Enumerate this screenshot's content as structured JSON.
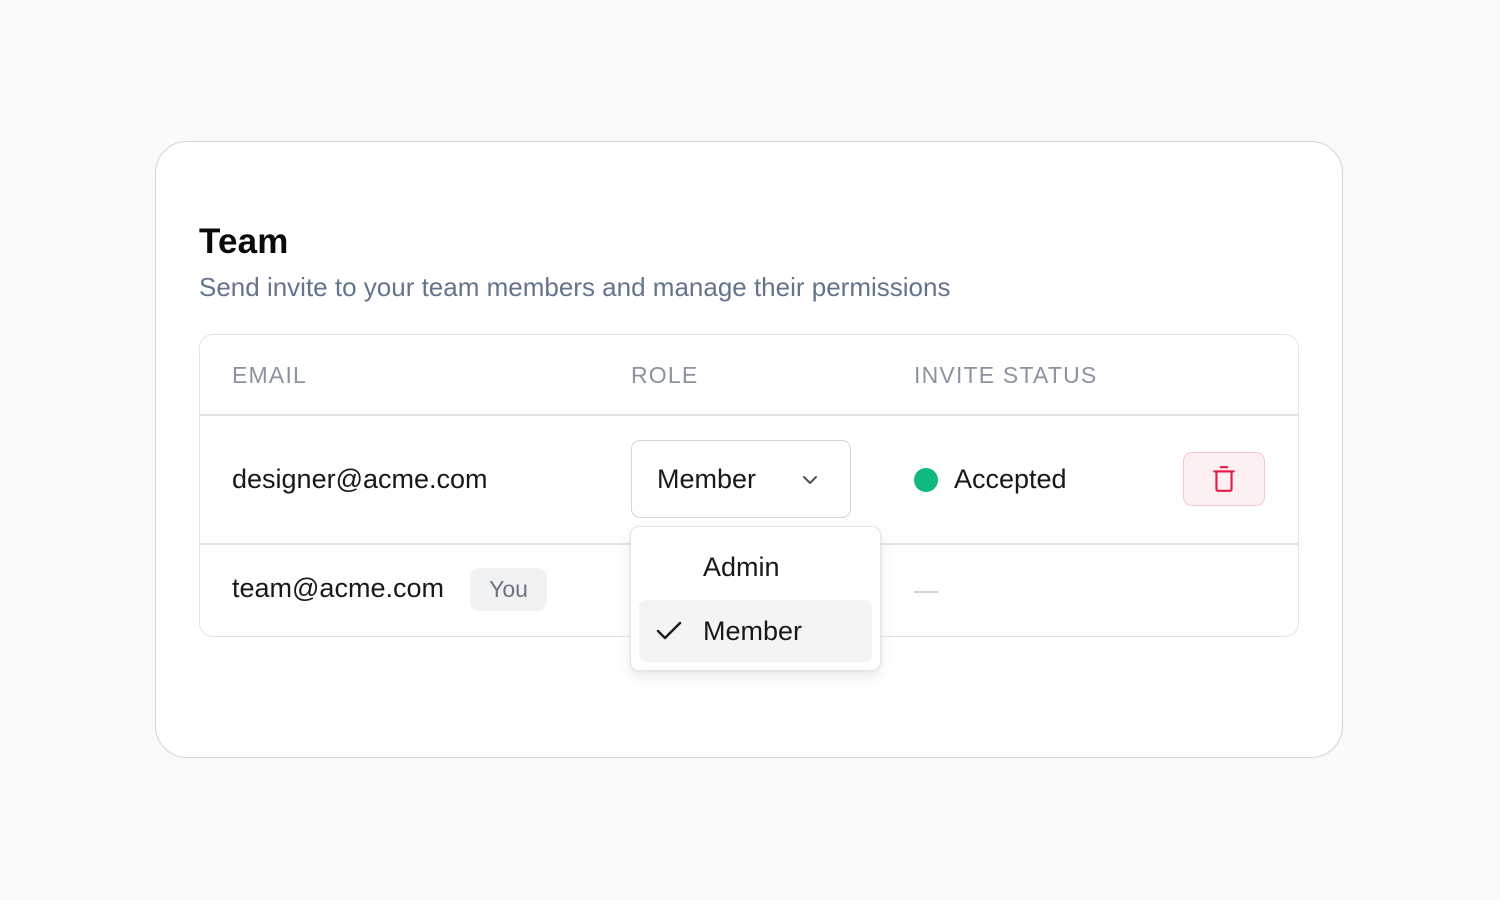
{
  "card": {
    "title": "Team",
    "subtitle": "Send invite to your team members and manage their permissions"
  },
  "table": {
    "columns": [
      "EMAIL",
      "ROLE",
      "INVITE STATUS"
    ],
    "rows": [
      {
        "email": "designer@acme.com",
        "role": "Member",
        "status": "Accepted",
        "status_color": "#10b981",
        "action_icon": "trash-icon"
      },
      {
        "email": "team@acme.com",
        "badge": "You",
        "role": "",
        "status": "—"
      }
    ]
  },
  "role_dropdown": {
    "open": true,
    "selected": "Member",
    "options": [
      "Admin",
      "Member"
    ]
  },
  "colors": {
    "accent_success": "#10b981",
    "danger": "#e11d48",
    "danger_bg": "#fdf0f2"
  }
}
